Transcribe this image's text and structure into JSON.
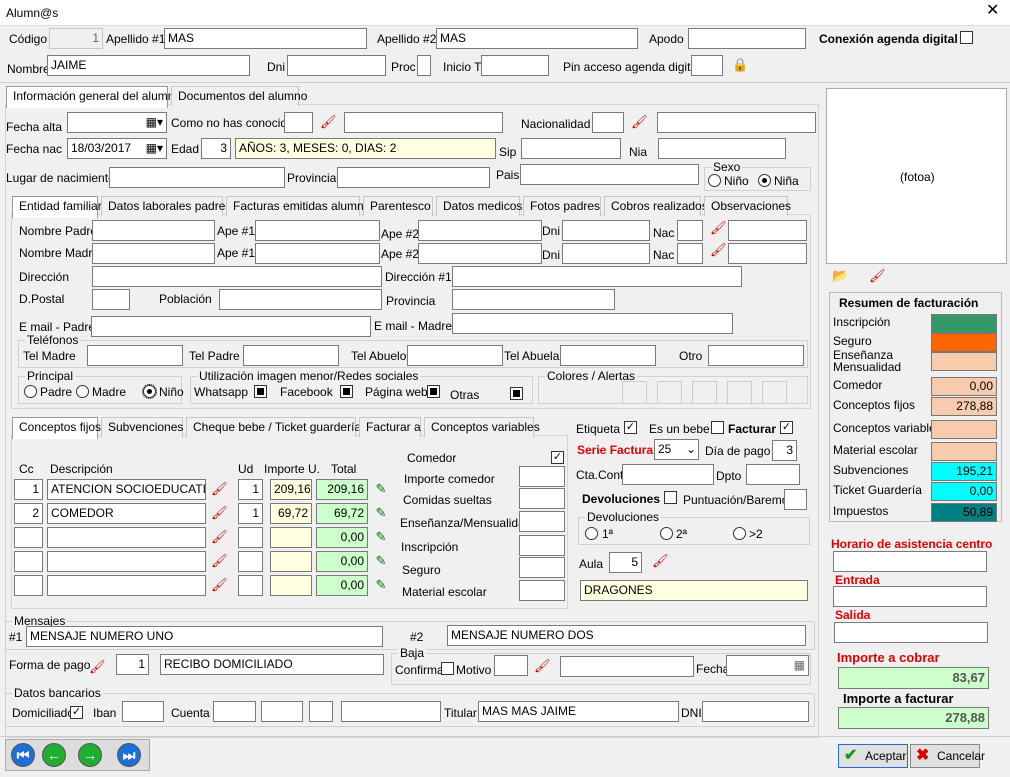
{
  "window": {
    "title": "Alumn@s",
    "close": "✕"
  },
  "top": {
    "codigo_l": "Código",
    "codigo_v": "1",
    "ape1_l": "Apellido #1",
    "ape1_v": "MAS",
    "ape2_l": "Apellido #2",
    "ape2_v": "MAS",
    "apodo_l": "Apodo",
    "agenda_l": "Conexión agenda digital",
    "nombre_l": "Nombre",
    "nombre_v": "JAIME",
    "dni_l": "Dni",
    "proc_l": "Proc",
    "inicio_l": "Inicio T.",
    "pin_l": "Pin acceso agenda digital"
  },
  "maintabs": [
    "Información general del alumno",
    "Documentos del alumno"
  ],
  "general": {
    "fecha_alta_l": "Fecha alta",
    "como_l": "Como no has conocido",
    "nacionalidad_l": "Nacionalidad",
    "fecha_nac_l": "Fecha nac",
    "fecha_nac_v": "18/03/2017",
    "edad_l": "Edad",
    "edad_v": "3",
    "edad_txt": "AÑOS: 3, MESES: 0, DIAS: 2",
    "sip_l": "Sip",
    "nia_l": "Nia",
    "lugar_l": "Lugar de nacimiento",
    "provincia_l": "Provincia",
    "pais_l": "Pais",
    "sexo_l": "Sexo",
    "nino_l": "Niño",
    "nina_l": "Niña"
  },
  "subtabs": [
    "Entidad familiar",
    "Datos laborales padres",
    "Facturas emitidas alumno",
    "Parentesco",
    "Datos medicos",
    "Fotos padres",
    "Cobros realizados",
    "Observaciones"
  ],
  "familia": {
    "padre_l": "Nombre Padre",
    "madre_l": "Nombre Madre",
    "ape1_l": "Ape #1",
    "ape2_l": "Ape #2",
    "dni_l": "Dni",
    "nac_l": "Nac",
    "direccion_l": "Dirección",
    "direccion1_l": "Dirección #1",
    "dpostal_l": "D.Postal",
    "poblacion_l": "Población",
    "provincia_l": "Provincia",
    "email_padre_l": "E mail - Padre",
    "email_madre_l": "E mail - Madre",
    "telefonos_l": "Teléfonos",
    "tel_madre_l": "Tel Madre",
    "tel_padre_l": "Tel Padre",
    "tel_abuelo_l": "Tel Abuelo",
    "tel_abuela_l": "Tel Abuela",
    "otro_l": "Otro",
    "principal_l": "Principal",
    "padre_r": "Padre",
    "madre_r": "Madre",
    "nino_r": "Niño",
    "util_l": "Utilización imagen menor/Redes sociales",
    "whatsapp": "Whatsapp",
    "facebook": "Facebook",
    "pagina": "Página web",
    "otras": "Otras",
    "colores_l": "Colores / Alertas"
  },
  "concepttabs": [
    "Conceptos fijos",
    "Subvenciones",
    "Cheque bebe / Ticket guardería",
    "Facturar a",
    "Conceptos variables"
  ],
  "conceptos": {
    "headers": {
      "cc": "Cc",
      "desc": "Descripción",
      "ud": "Ud",
      "imp": "Importe U.",
      "total": "Total"
    },
    "rows": [
      {
        "cc": "1",
        "desc": "ATENCION SOCIOEDUCATIVA",
        "ud": "1",
        "imp": "209,16",
        "total": "209,16"
      },
      {
        "cc": "2",
        "desc": "COMEDOR",
        "ud": "1",
        "imp": "69,72",
        "total": "69,72"
      },
      {
        "cc": "",
        "desc": "",
        "ud": "",
        "imp": "",
        "total": "0,00"
      },
      {
        "cc": "",
        "desc": "",
        "ud": "",
        "imp": "",
        "total": "0,00"
      },
      {
        "cc": "",
        "desc": "",
        "ud": "",
        "imp": "",
        "total": "0,00"
      }
    ],
    "comedor_l": "Comedor",
    "importe_comedor_l": "Importe comedor",
    "comidas_l": "Comidas sueltas",
    "ensenanza_l": "Enseñanza/Mensualidad",
    "inscripcion_l": "Inscripción",
    "seguro_l": "Seguro",
    "material_l": "Material escolar"
  },
  "fact": {
    "etiqueta_l": "Etiqueta",
    "bebe_l": "Es un bebe",
    "facturar_l": "Facturar",
    "serie_l": "Serie Factura",
    "serie_v": "25",
    "dia_l": "Día de pago",
    "dia_v": "3",
    "cta_l": "Cta.Cont.",
    "dpto_l": "Dpto",
    "devol_l": "Devoluciones",
    "puntuacion_l": "Puntuación/Baremo",
    "devol_g": "Devoluciones",
    "r1": "1ª",
    "r2": "2ª",
    "r3": ">2",
    "aula_l": "Aula",
    "aula_v": "5",
    "aula_name": "DRAGONES"
  },
  "mensajes": {
    "title": "Mensajes",
    "m1_l": "#1",
    "m1_v": "MENSAJE NUMERO UNO",
    "m2_l": "#2",
    "m2_v": "MENSAJE NUMERO DOS"
  },
  "pago": {
    "forma_l": "Forma de pago",
    "forma_n": "1",
    "forma_v": "RECIBO DOMICILIADO",
    "baja_l": "Baja",
    "confirmar_l": "Confirmar",
    "motivo_l": "Motivo",
    "fecha_l": "Fecha"
  },
  "banco": {
    "title": "Datos bancarios",
    "domiciliado_l": "Domiciliado",
    "iban_l": "Iban",
    "cuenta_l": "Cuenta",
    "titular_l": "Titular",
    "titular_v": "MAS MAS JAIME",
    "dni_l": "DNI"
  },
  "right": {
    "foto": "(fotoa)",
    "resumen_title": "Resumen de facturación",
    "resumen": [
      {
        "label": "Inscripción",
        "value": "",
        "color": "#339966"
      },
      {
        "label": "Seguro",
        "value": "",
        "color": "#ff6600"
      },
      {
        "label": "Enseñanza\nMensualidad",
        "value": "",
        "color": "#f8cbad"
      },
      {
        "label": "Comedor",
        "value": "0,00",
        "color": "#f8cbad"
      },
      {
        "label": "Conceptos fijos",
        "value": "278,88",
        "color": "#f8cbad"
      },
      {
        "label": "Conceptos variables",
        "value": "",
        "color": "#f8cbad"
      },
      {
        "label": "Material escolar",
        "value": "",
        "color": "#f8cbad"
      },
      {
        "label": "Subvenciones",
        "value": "195,21",
        "color": "#00ffff"
      },
      {
        "label": "Ticket Guardería",
        "value": "0,00",
        "color": "#00ffff"
      },
      {
        "label": "Impuestos",
        "value": "50,89",
        "color": "#008080"
      }
    ],
    "horario_l": "Horario de asistencia centro",
    "entrada_l": "Entrada",
    "salida_l": "Salida",
    "cobrar_l": "Importe a cobrar",
    "cobrar_v": "83,67",
    "facturar_l": "Importe a facturar",
    "facturar_v": "278,88"
  },
  "bottom": {
    "aceptar": "Aceptar",
    "cancelar": "Cancelar"
  }
}
